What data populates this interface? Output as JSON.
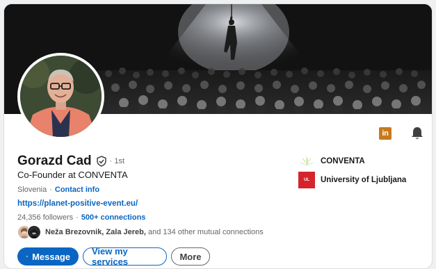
{
  "profile": {
    "name": "Gorazd Cad",
    "degree": "· 1st",
    "headline": "Co-Founder at CONVENTA",
    "location": "Slovenia",
    "contact_label": "Contact info",
    "website": "https://planet-positive-event.eu/",
    "followers": "24,356 followers",
    "connections": "500+ connections",
    "mutual": {
      "names": "Neža Brezovnik, Zala Jereb,",
      "rest": " and 134 other mutual connections"
    }
  },
  "actions": {
    "message_label": "Message",
    "services_label": "View my services",
    "more_label": "More"
  },
  "organizations": [
    {
      "name": "CONVENTA",
      "logo": "conventa-leaf-logo"
    },
    {
      "name": "University of Ljubljana",
      "logo_text": "UL",
      "logo": "university-logo"
    }
  ],
  "icons": {
    "linkedin_badge": "in",
    "verified": "verified-shield-icon",
    "bell": "bell-icon",
    "send": "send-icon"
  },
  "colors": {
    "brand_blue": "#0a66c2",
    "linkedin_badge": "#c77a1d",
    "conventa_green": "#8cc63f",
    "ul_red": "#d6242b"
  }
}
